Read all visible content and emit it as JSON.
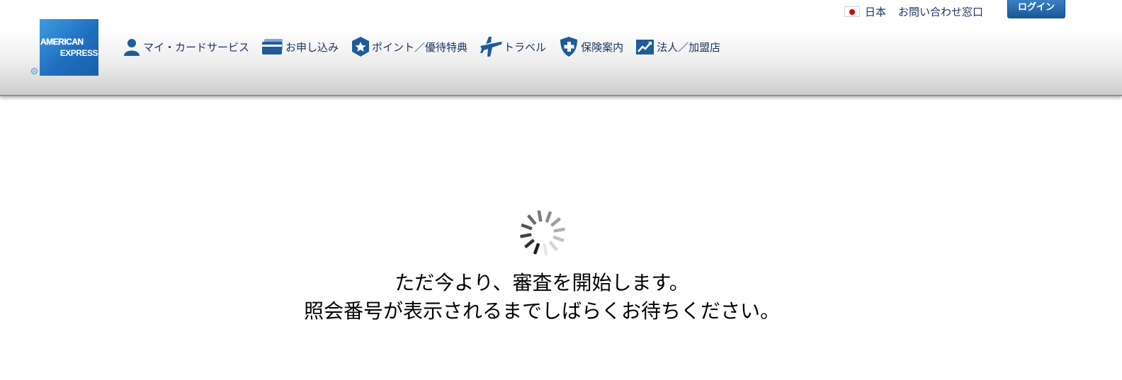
{
  "brand": {
    "logo_line1": "AMERICAN",
    "logo_line2": "EXPRESS"
  },
  "utility": {
    "region": "日本",
    "contact": "お問い合わせ窓口",
    "login": "ログイン"
  },
  "nav": {
    "items": [
      {
        "label": "マイ・カードサービス",
        "icon": "person-icon"
      },
      {
        "label": "お申し込み",
        "icon": "card-icon"
      },
      {
        "label": "ポイント／優待特典",
        "icon": "star-shield-icon"
      },
      {
        "label": "トラベル",
        "icon": "airplane-icon"
      },
      {
        "label": "保険案内",
        "icon": "shield-plus-icon"
      },
      {
        "label": "法人／加盟店",
        "icon": "chart-trend-icon"
      }
    ]
  },
  "main": {
    "loading_icon": "loading-spinner-icon",
    "line1": "ただ今より、審査を開始します。",
    "line2": "照会番号が表示されるまでしばらくお待ちください。"
  },
  "colors": {
    "brand_blue": "#2671b9",
    "nav_text": "#1b3563",
    "login_button": "#1b5797"
  }
}
